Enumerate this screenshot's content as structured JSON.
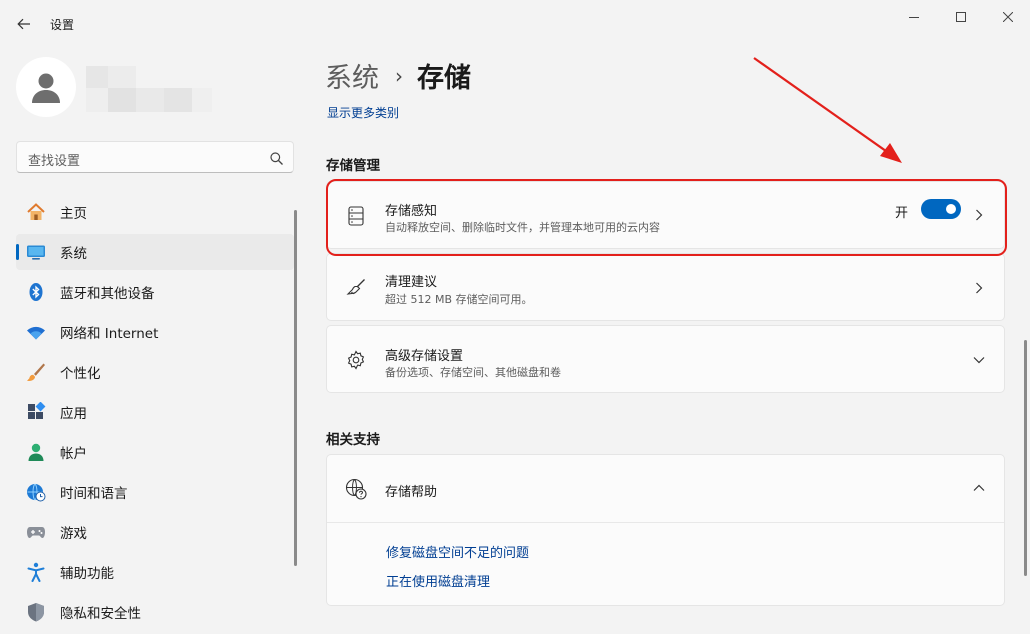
{
  "window": {
    "title": "设置"
  },
  "search": {
    "placeholder": "查找设置"
  },
  "sidebar": {
    "items": [
      {
        "label": "主页",
        "icon": "home-icon"
      },
      {
        "label": "系统",
        "icon": "monitor-icon",
        "active": true
      },
      {
        "label": "蓝牙和其他设备",
        "icon": "bluetooth-icon"
      },
      {
        "label": "网络和 Internet",
        "icon": "wifi-icon"
      },
      {
        "label": "个性化",
        "icon": "brush-icon"
      },
      {
        "label": "应用",
        "icon": "apps-icon"
      },
      {
        "label": "帐户",
        "icon": "account-icon"
      },
      {
        "label": "时间和语言",
        "icon": "globe-clock-icon"
      },
      {
        "label": "游戏",
        "icon": "gamepad-icon"
      },
      {
        "label": "辅助功能",
        "icon": "accessibility-icon"
      },
      {
        "label": "隐私和安全性",
        "icon": "shield-icon"
      }
    ]
  },
  "breadcrumb": {
    "parent": "系统",
    "separator": "›",
    "current": "存储"
  },
  "main": {
    "more_categories": "显示更多类别",
    "storage_management": {
      "heading": "存储管理",
      "storage_sense": {
        "title": "存储感知",
        "subtitle": "自动释放空间、删除临时文件，并管理本地可用的云内容",
        "toggle_label": "开",
        "toggle_on": true
      },
      "cleanup": {
        "title": "清理建议",
        "subtitle": "超过 512 MB 存储空间可用。"
      },
      "advanced": {
        "title": "高级存储设置",
        "subtitle": "备份选项、存储空间、其他磁盘和卷"
      }
    },
    "related": {
      "heading": "相关支持",
      "help": {
        "title": "存储帮助",
        "links": [
          "修复磁盘空间不足的问题",
          "正在使用磁盘清理"
        ]
      }
    }
  },
  "colors": {
    "accent": "#0067c0",
    "annotation": "#e3201b",
    "link": "#003e92"
  }
}
